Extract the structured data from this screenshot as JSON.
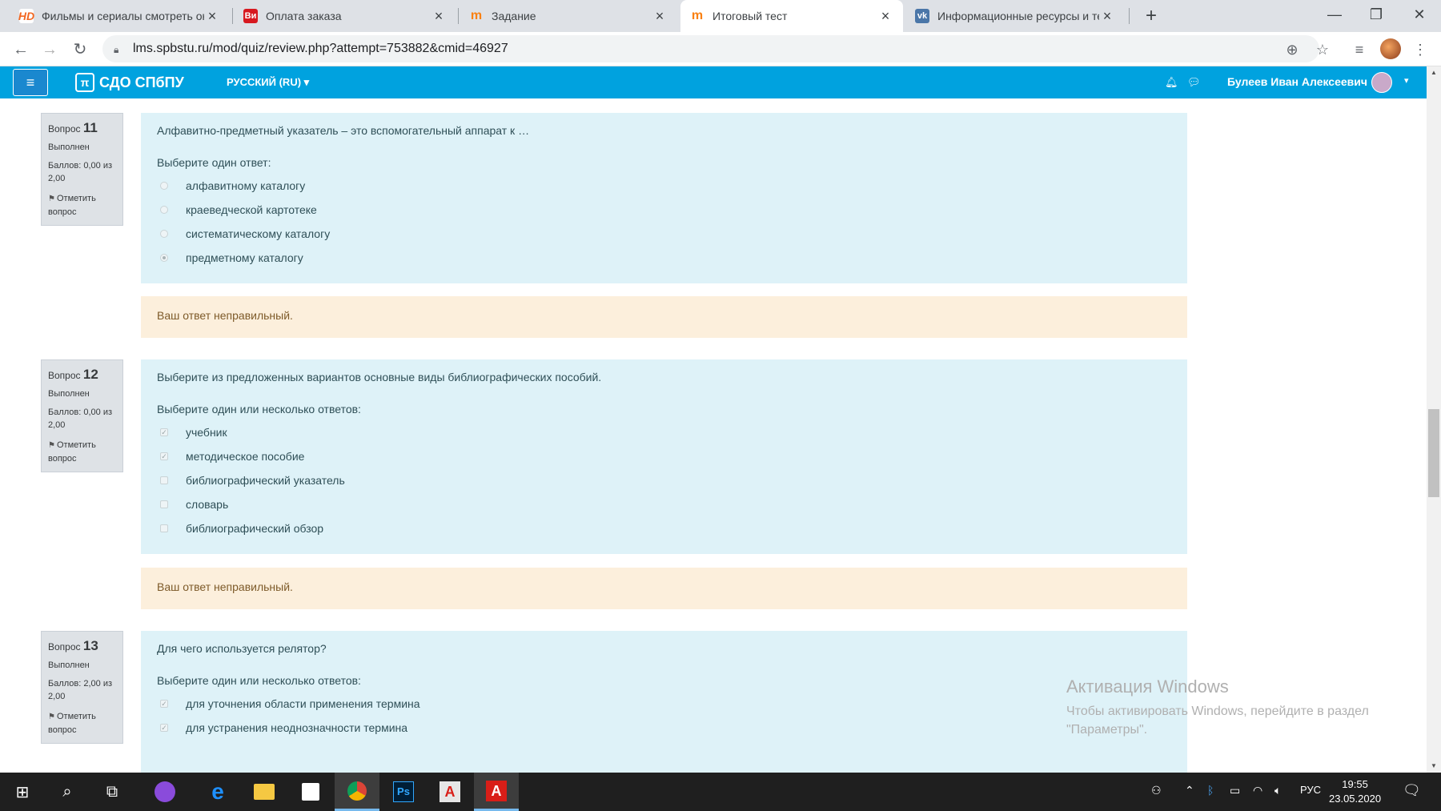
{
  "browser": {
    "tabs": [
      {
        "title": "Фильмы и сериалы смотреть он",
        "icon": "hd-icon",
        "color": "#f26722",
        "active": false
      },
      {
        "title": "Оплата заказа",
        "icon": "vi-icon",
        "color": "#d71920",
        "active": false
      },
      {
        "title": "Задание",
        "icon": "moodle-icon",
        "color": "#f98012",
        "active": false
      },
      {
        "title": "Итоговый тест",
        "icon": "moodle-icon",
        "color": "#f98012",
        "active": true
      },
      {
        "title": "Информационные ресурсы и те",
        "icon": "vk-icon",
        "color": "#4a76a8",
        "active": false
      }
    ],
    "url": "lms.spbstu.ru/mod/quiz/review.php?attempt=753882&cmid=46927"
  },
  "header": {
    "brand": "СДО СПбПУ",
    "language": "РУССКИЙ (RU)",
    "username": "Булеев Иван Алексеевич"
  },
  "questions": [
    {
      "label": "Вопрос",
      "number": "11",
      "state": "Выполнен",
      "grade": "Баллов: 0,00 из 2,00",
      "flag": "Отметить вопрос",
      "text": "Алфавитно-предметный указатель – это вспомогательный аппарат к …",
      "prompt": "Выберите один ответ:",
      "type": "radio",
      "answers": [
        {
          "label": "алфавитному каталогу",
          "checked": false
        },
        {
          "label": "краеведческой картотеке",
          "checked": false
        },
        {
          "label": "систематическому каталогу",
          "checked": false
        },
        {
          "label": "предметному каталогу",
          "checked": true
        }
      ],
      "feedback": "Ваш ответ неправильный."
    },
    {
      "label": "Вопрос",
      "number": "12",
      "state": "Выполнен",
      "grade": "Баллов: 0,00 из 2,00",
      "flag": "Отметить вопрос",
      "text": "Выберите из предложенных вариантов основные виды библиографических пособий.",
      "prompt": "Выберите один или несколько ответов:",
      "type": "checkbox",
      "answers": [
        {
          "label": "учебник",
          "checked": true
        },
        {
          "label": "методическое пособие",
          "checked": true
        },
        {
          "label": "библиографический указатель",
          "checked": false
        },
        {
          "label": "словарь",
          "checked": false
        },
        {
          "label": "библиографический обзор",
          "checked": false
        }
      ],
      "feedback": "Ваш ответ неправильный."
    },
    {
      "label": "Вопрос",
      "number": "13",
      "state": "Выполнен",
      "grade": "Баллов: 2,00 из 2,00",
      "flag": "Отметить вопрос",
      "text": "Для чего используется релятор?",
      "prompt": "Выберите один или несколько ответов:",
      "type": "checkbox",
      "answers": [
        {
          "label": "для уточнения области применения термина",
          "checked": true
        },
        {
          "label": "для устранения неоднозначности термина",
          "checked": true
        }
      ]
    }
  ],
  "watermark": {
    "title": "Активация Windows",
    "text": "Чтобы активировать Windows, перейдите в раздел \"Параметры\"."
  },
  "taskbar": {
    "language": "РУС",
    "time": "19:55",
    "date": "23.05.2020"
  },
  "colors": {
    "moodle_header": "#00a2df",
    "question_bg": "#def2f8",
    "feedback_bg": "#fcefdc",
    "info_bg": "#dee2e6"
  }
}
